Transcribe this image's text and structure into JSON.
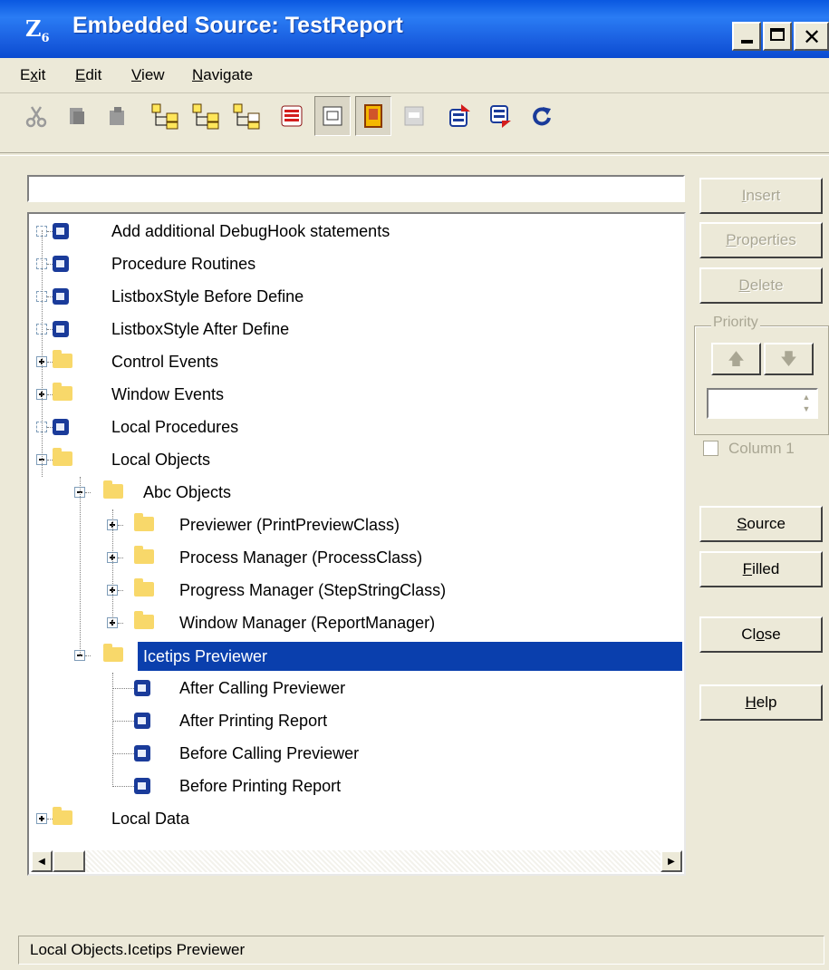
{
  "window": {
    "title": "Embedded Source: TestReport",
    "app_icon_glyph": "Z",
    "app_icon_sub": "6"
  },
  "menu": {
    "items": [
      {
        "label": "Exit",
        "mnemonic": "x"
      },
      {
        "label": "Edit",
        "mnemonic": "E"
      },
      {
        "label": "View",
        "mnemonic": "V"
      },
      {
        "label": "Navigate",
        "mnemonic": "N"
      }
    ]
  },
  "toolbar": {
    "icons": [
      "cut-icon",
      "copy-icon",
      "paste-icon",
      "tree-expand-icon",
      "tree-collapse-icon",
      "tree-branch-icon",
      "priority-list-icon",
      "embed-view-icon",
      "filled-only-icon",
      "template-icon",
      "move-up-icon",
      "move-down-icon",
      "refresh-icon"
    ]
  },
  "filter": {
    "value": ""
  },
  "tree": {
    "items": [
      {
        "label": "Add additional DebugHook statements",
        "type": "embed",
        "level": 0
      },
      {
        "label": "Procedure Routines",
        "type": "embed",
        "level": 0
      },
      {
        "label": "ListboxStyle Before Define",
        "type": "embed",
        "level": 0
      },
      {
        "label": "ListboxStyle After Define",
        "type": "embed",
        "level": 0
      },
      {
        "label": "Control Events",
        "type": "folder",
        "level": 0,
        "state": "collapsed"
      },
      {
        "label": "Window Events",
        "type": "folder",
        "level": 0,
        "state": "collapsed"
      },
      {
        "label": "Local Procedures",
        "type": "embed",
        "level": 0
      },
      {
        "label": "Local Objects",
        "type": "folder",
        "level": 0,
        "state": "expanded"
      },
      {
        "label": "Abc Objects",
        "type": "folder",
        "level": 1,
        "state": "expanded"
      },
      {
        "label": "Previewer (PrintPreviewClass)",
        "type": "folder",
        "level": 2,
        "state": "collapsed"
      },
      {
        "label": "Process Manager (ProcessClass)",
        "type": "folder",
        "level": 2,
        "state": "collapsed"
      },
      {
        "label": "Progress Manager (StepStringClass)",
        "type": "folder",
        "level": 2,
        "state": "collapsed"
      },
      {
        "label": "Window Manager (ReportManager)",
        "type": "folder",
        "level": 2,
        "state": "collapsed"
      },
      {
        "label": "Icetips Previewer",
        "type": "folder",
        "level": 1,
        "state": "expanded",
        "selected": true
      },
      {
        "label": "After Calling Previewer",
        "type": "embed",
        "level": 2
      },
      {
        "label": "After Printing Report",
        "type": "embed",
        "level": 2
      },
      {
        "label": "Before Calling Previewer",
        "type": "embed",
        "level": 2
      },
      {
        "label": "Before Printing Report",
        "type": "embed",
        "level": 2
      },
      {
        "label": "Local Data",
        "type": "folder",
        "level": 0,
        "state": "collapsed"
      }
    ]
  },
  "buttons": {
    "insert": "Insert",
    "properties": "Properties",
    "delete": "Delete",
    "source": "Source",
    "filled": "Filled",
    "close": "Close",
    "help": "Help"
  },
  "priority": {
    "legend": "Priority",
    "up_glyph": "🡅",
    "down_glyph": "🡇",
    "value": ""
  },
  "column": {
    "label": "Column 1",
    "checked": false
  },
  "status": {
    "text": "Local Objects.Icetips Previewer"
  },
  "colors": {
    "title_bar": "#1a5fe0",
    "selection": "#0a3fad",
    "face": "#ece9d8",
    "folder": "#f8d86a"
  }
}
